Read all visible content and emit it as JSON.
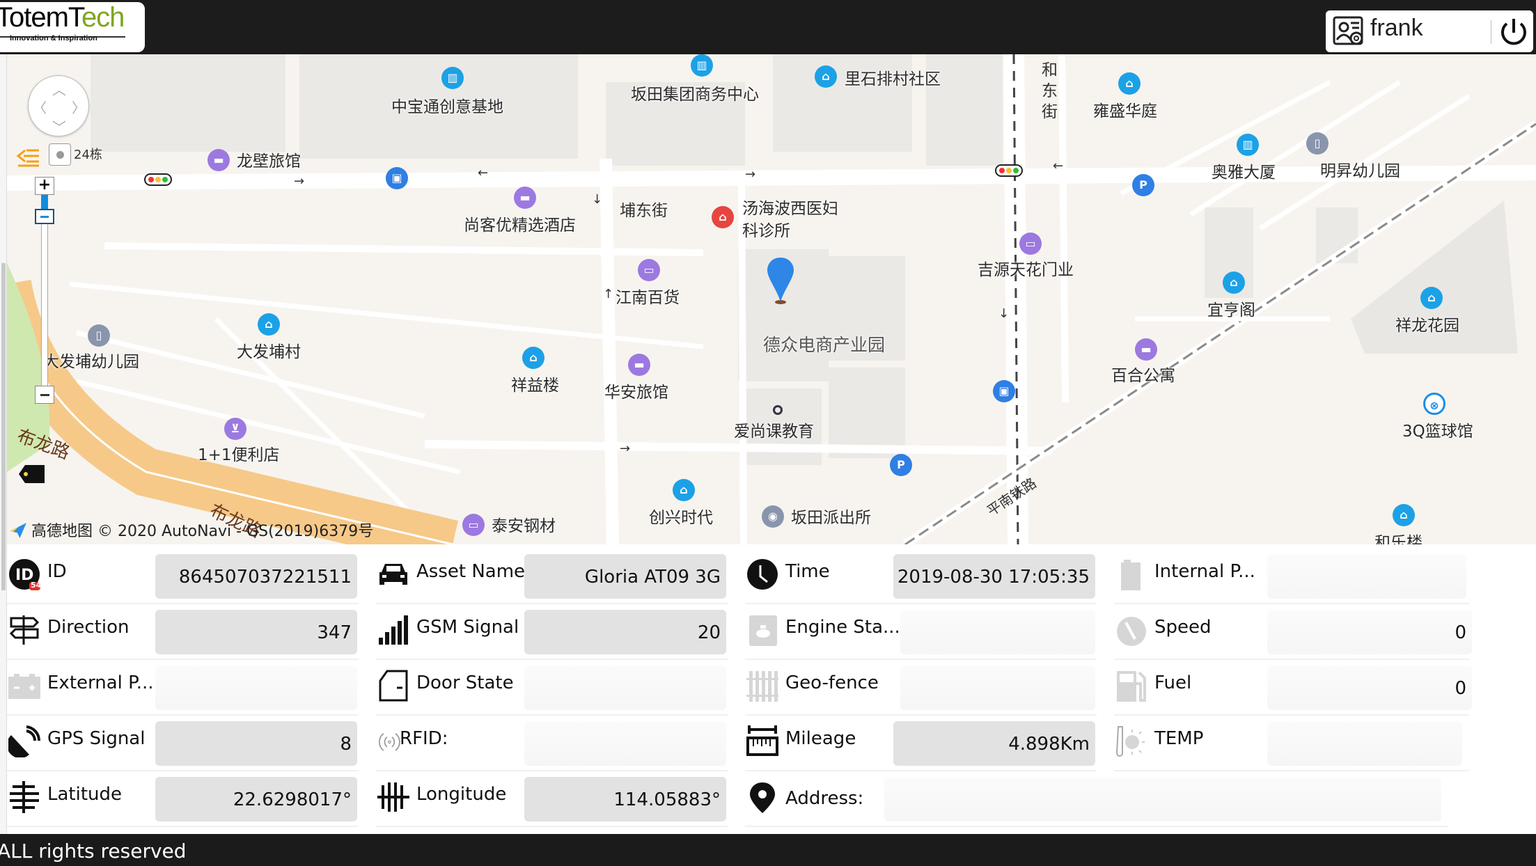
{
  "header": {
    "logo_main_a": "TotemT",
    "logo_main_b": "ech",
    "logo_tagline": "Innovation & Inspiration",
    "username": "frank",
    "user_icon": "user-settings-icon",
    "power_icon": "power-icon"
  },
  "map": {
    "floor_label": "24栋",
    "attribution_brand": "高德地图",
    "attribution_text": "© 2020 AutoNavi - GS(2019)6379号",
    "roads": [
      "布龙路",
      "布龙路",
      "埔东街",
      "和东街",
      "平南铁路"
    ],
    "pois": [
      {
        "name": "中宝通创意基地",
        "icon": "building-icon"
      },
      {
        "name": "坂田集团商务中心",
        "icon": "building-icon"
      },
      {
        "name": "里石排村社区",
        "icon": "residential-icon"
      },
      {
        "name": "雍盛华庭",
        "icon": "residential-icon"
      },
      {
        "name": "奥雅大厦",
        "icon": "building-icon"
      },
      {
        "name": "明昇幼儿园",
        "icon": "kindergarten-icon"
      },
      {
        "name": "龙壁旅馆",
        "icon": "hotel-icon"
      },
      {
        "name": "尚客优精选酒店",
        "icon": "hotel-icon"
      },
      {
        "name": "汤海波西医妇科诊所",
        "icon": "clinic-icon"
      },
      {
        "name": "江南百货",
        "icon": "shopping-icon"
      },
      {
        "name": "吉源天花门业",
        "icon": "shop-icon"
      },
      {
        "name": "宜亨阁",
        "icon": "residential-icon"
      },
      {
        "name": "祥龙花园",
        "icon": "residential-icon"
      },
      {
        "name": "大发埔幼儿园",
        "icon": "kindergarten-icon"
      },
      {
        "name": "大发埔村",
        "icon": "residential-icon"
      },
      {
        "name": "祥益楼",
        "icon": "residential-icon"
      },
      {
        "name": "华安旅馆",
        "icon": "hotel-icon"
      },
      {
        "name": "德众电商产业园",
        "icon": "none"
      },
      {
        "name": "百合公寓",
        "icon": "hotel-icon"
      },
      {
        "name": "爱尚课教育",
        "icon": "dot-icon"
      },
      {
        "name": "3Q篮球馆",
        "icon": "basketball-icon"
      },
      {
        "name": "1+1便利店",
        "icon": "cart-icon"
      },
      {
        "name": "创兴时代",
        "icon": "residential-icon"
      },
      {
        "name": "坂田派出所",
        "icon": "police-icon"
      },
      {
        "name": "泰安钢材",
        "icon": "shop-icon"
      },
      {
        "name": "和乐楼",
        "icon": "residential-icon"
      }
    ]
  },
  "fields": [
    {
      "label": "ID",
      "value": "864507037221511",
      "icon": "id-icon",
      "filled": true,
      "badge": "54"
    },
    {
      "label": "Asset Name",
      "value": "Gloria AT09 3G",
      "icon": "car-icon",
      "filled": true
    },
    {
      "label": "Time",
      "value": "2019-08-30 17:05:35",
      "icon": "clock-icon",
      "filled": true
    },
    {
      "label": "Internal P...",
      "value": "",
      "icon": "battery-icon",
      "filled": false
    },
    {
      "label": "Direction",
      "value": "347",
      "icon": "signpost-icon",
      "filled": true
    },
    {
      "label": "GSM Signal",
      "value": "20",
      "icon": "signal-bars-icon",
      "filled": true
    },
    {
      "label": "Engine Sta...",
      "value": "",
      "icon": "engine-icon",
      "filled": false
    },
    {
      "label": "Speed",
      "value": "0",
      "icon": "speedometer-icon",
      "filled": false
    },
    {
      "label": "External P...",
      "value": "",
      "icon": "car-battery-icon",
      "filled": false
    },
    {
      "label": "Door State",
      "value": "",
      "icon": "door-icon",
      "filled": false
    },
    {
      "label": "Geo-fence",
      "value": "",
      "icon": "fence-icon",
      "filled": false
    },
    {
      "label": "Fuel",
      "value": "0",
      "icon": "fuel-pump-icon",
      "filled": false
    },
    {
      "label": "GPS Signal",
      "value": "8",
      "icon": "satellite-dish-icon",
      "filled": true
    },
    {
      "label": "RFID:",
      "value": "",
      "icon": "rfid-icon",
      "filled": false
    },
    {
      "label": "Mileage",
      "value": "4.898Km",
      "icon": "ruler-icon",
      "filled": true
    },
    {
      "label": "TEMP",
      "value": "",
      "icon": "thermometer-icon",
      "filled": false
    },
    {
      "label": "Latitude",
      "value": "22.6298017°",
      "icon": "latitude-icon",
      "filled": true
    },
    {
      "label": "Longitude",
      "value": "114.05883°",
      "icon": "longitude-icon",
      "filled": true
    },
    {
      "label": "Address:",
      "value": "",
      "icon": "location-pin-icon",
      "filled": false
    }
  ],
  "footer": {
    "text": "ALL rights reserved"
  }
}
